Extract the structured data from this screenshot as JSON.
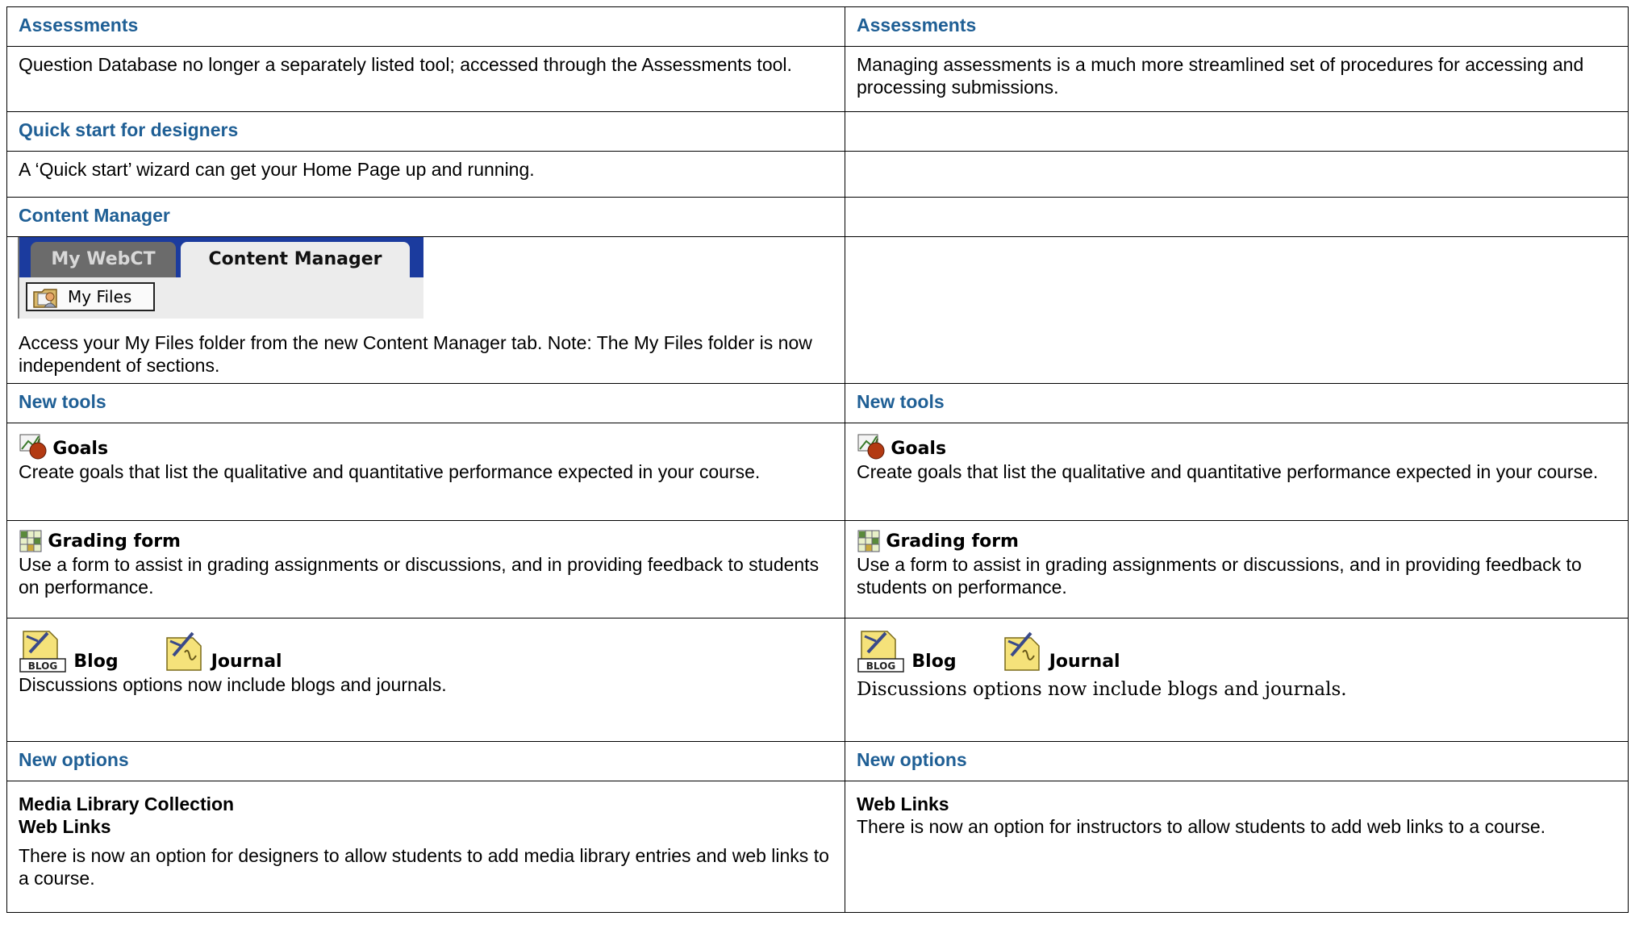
{
  "left": {
    "assessments_header": "Assessments",
    "assessments_text": "Question Database no longer a separately listed tool; accessed through the Assessments tool.",
    "quick_start_header": "Quick start for designers",
    "quick_start_text": "A ‘Quick start’ wizard can get your Home Page up and running.",
    "content_manager_header": "Content Manager",
    "content_manager_screenshot": {
      "tab_inactive": "My WebCT",
      "tab_active": "Content Manager",
      "button": "My Files"
    },
    "content_manager_text": "Access your My Files folder from the new Content Manager tab. Note: The My Files folder is now independent of sections.",
    "new_tools_header": "New tools",
    "goals_title": "Goals",
    "goals_text": "Create goals that list the qualitative and quantitative performance expected in your course.",
    "grading_title": "Grading form",
    "grading_text": "Use a form to assist in grading assignments or discussions, and in providing feedback to students on performance.",
    "blog_title": "Blog",
    "journal_title": "Journal",
    "blog_text": "Discussions options now include blogs and journals.",
    "new_options_header": "New options",
    "options_line1": "Media Library Collection",
    "options_line2": "Web Links",
    "options_text": "There is now an option for designers to allow students to add media library entries and web links to a course."
  },
  "right": {
    "assessments_header": "Assessments",
    "assessments_text": "Managing assessments is a much more streamlined set of procedures for accessing and processing submissions.",
    "new_tools_header": "New tools",
    "goals_title": "Goals",
    "goals_text": "Create goals that list the qualitative and quantitative performance expected in your course.",
    "grading_title": "Grading form",
    "grading_text": "Use a form to assist in grading assignments or discussions, and in providing feedback to students on performance.",
    "blog_title": "Blog",
    "journal_title": "Journal",
    "blog_text": "Discussions options now include blogs and journals.",
    "new_options_header": "New options",
    "options_line1": "Web Links",
    "options_text": "There is now an option for instructors to allow students to add web links to a course."
  },
  "icons": {
    "goals": "goals-apple-icon",
    "grading": "grading-form-grid-icon",
    "blog": "blog-icon",
    "journal": "journal-icon",
    "my_files": "my-files-folder-icon"
  },
  "colors": {
    "header_text": "#1f5f95",
    "tab_bar": "#1b3b9e"
  }
}
